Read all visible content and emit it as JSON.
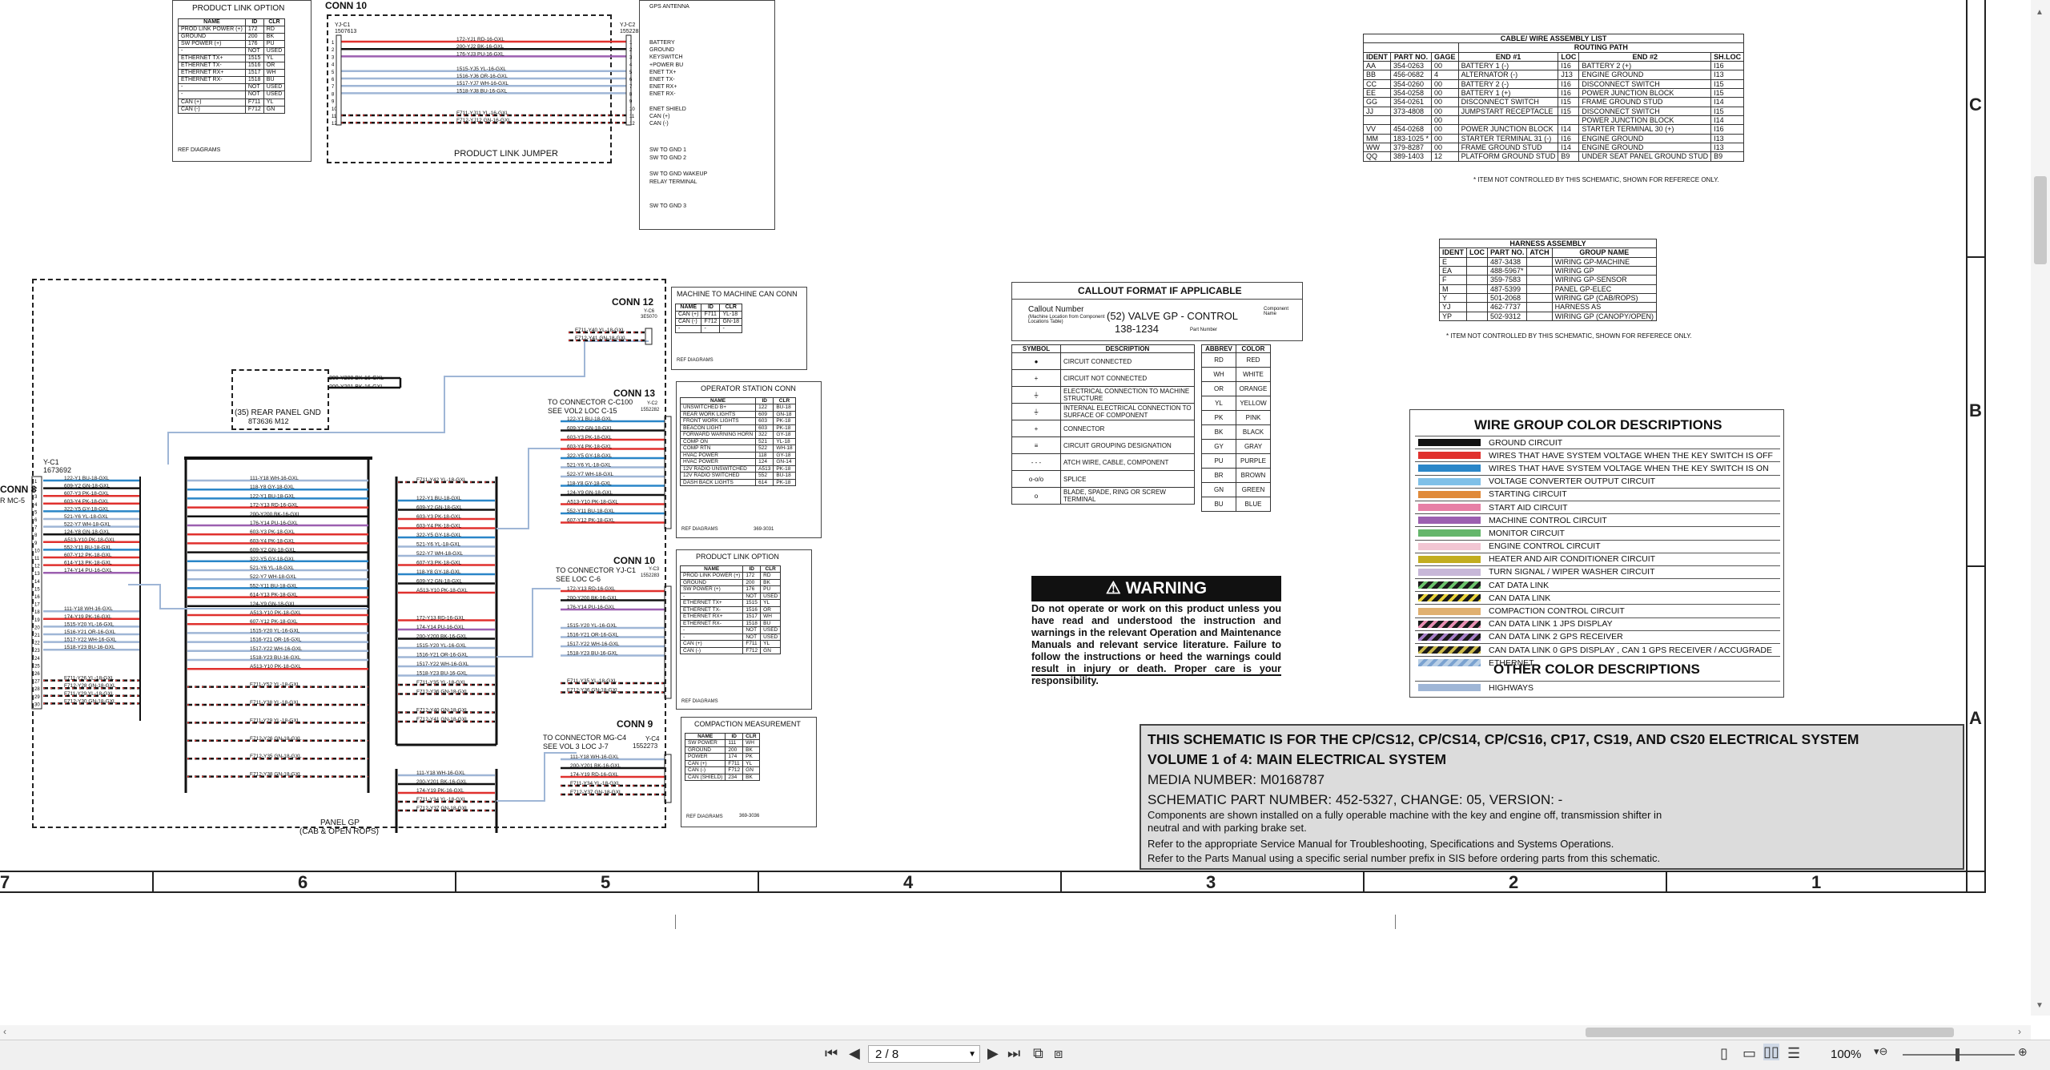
{
  "product_link_top": {
    "title": "PRODUCT LINK OPTION",
    "headers": [
      "NAME",
      "ID",
      "CLR"
    ],
    "rows": [
      [
        "PROD LINK POWER (+)",
        "172",
        "RD"
      ],
      [
        "GROUND",
        "200",
        "BK"
      ],
      [
        "SW POWER (+)",
        "176",
        "PU"
      ],
      [
        "-",
        "NOT",
        "USED"
      ],
      [
        "ETHERNET TX+",
        "1515",
        "YL"
      ],
      [
        "ETHERNET TX-",
        "1516",
        "OR"
      ],
      [
        "ETHERNET RX+",
        "1517",
        "WH"
      ],
      [
        "ETHERNET RX-",
        "1518",
        "BU"
      ],
      [
        "-",
        "NOT",
        "USED"
      ],
      [
        "-",
        "NOT",
        "USED"
      ],
      [
        "CAN (+)",
        "F711",
        "YL"
      ],
      [
        "CAN (-)",
        "F712",
        "GN"
      ]
    ],
    "ref": "REF DIAGRAMS"
  },
  "conn10_top": {
    "title": "CONN 10",
    "left_id": "YJ-C1",
    "left_part": "1507613",
    "right_id": "YJ-C2",
    "right_part": "1552283",
    "jumper": "PRODUCT LINK\nJUMPER",
    "wires": [
      "172-YJ1 RD-16-GXL",
      "200-YJ2 BK-16-GXL",
      "176-YJ3 PU-16-GXL",
      "",
      "1515-YJ5 YL-16-GXL",
      "1516-YJ6 OR-16-GXL",
      "1517-YJ7 WH-16-GXL",
      "1518-YJ8 BU-16-GXL",
      "",
      "",
      "F711-YJ11 YL-16-GXL",
      "F712-YJ12 GN-16-GXL"
    ],
    "right_labels": [
      "BATTERY",
      "GROUND",
      "KEYSWITCH",
      "+POWER BU",
      "ENET TX+",
      "ENET TX-",
      "ENET RX+",
      "ENET RX-",
      "",
      "ENET SHIELD",
      "CAN (+)",
      "CAN (-)"
    ],
    "gps_antenna": "GPS ANTENNA",
    "extra": [
      "SW TO GND 1",
      "SW TO GND 2",
      "",
      "SW TO GND WAKEUP",
      "RELAY TERMINAL",
      "",
      "",
      "SW TO GND 3"
    ]
  },
  "cable_list": {
    "title": "CABLE/ WIRE ASSEMBLY LIST",
    "routing": "ROUTING PATH",
    "headers": [
      "IDENT",
      "PART NO.",
      "GAGE",
      "END #1",
      "LOC",
      "END #2",
      "SH.LOC"
    ],
    "rows": [
      [
        "AA",
        "354-0263",
        "00",
        "BATTERY 1 (-)",
        "I16",
        "BATTERY 2 (+)",
        "I16"
      ],
      [
        "BB",
        "456-0682",
        "4",
        "ALTERNATOR (-)",
        "J13",
        "ENGINE GROUND",
        "I13"
      ],
      [
        "CC",
        "354-0260",
        "00",
        "BATTERY 2 (-)",
        "I16",
        "DISCONNECT SWITCH",
        "I15"
      ],
      [
        "EE",
        "354-0258",
        "00",
        "BATTERY 1 (+)",
        "I16",
        "POWER JUNCTION BLOCK",
        "I15"
      ],
      [
        "GG",
        "354-0261",
        "00",
        "DISCONNECT SWITCH",
        "I15",
        "FRAME GROUND STUD",
        "I14"
      ],
      [
        "JJ",
        "373-4808",
        "00",
        "JUMPSTART RECEPTACLE",
        "I15",
        "DISCONNECT SWITCH",
        "I15"
      ],
      [
        "",
        "",
        "00",
        "",
        "",
        "POWER JUNCTION BLOCK",
        "I14"
      ],
      [
        "VV",
        "454-0268",
        "00",
        "POWER JUNCTION BLOCK",
        "I14",
        "STARTER TERMINAL 30 (+)",
        "I16"
      ],
      [
        "MM",
        "183-1025 *",
        "00",
        "STARTER TERMINAL 31 (-)",
        "I16",
        "ENGINE GROUND",
        "I13"
      ],
      [
        "WW",
        "379-8287",
        "00",
        "FRAME GROUND STUD",
        "I14",
        "ENGINE GROUND",
        "I13"
      ],
      [
        "QQ",
        "389-1403",
        "12",
        "PLATFORM GROUND STUD",
        "B9",
        "UNDER SEAT PANEL GROUND STUD",
        "B9"
      ]
    ],
    "note": "* ITEM NOT CONTROLLED BY THIS SCHEMATIC, SHOWN FOR REFERECE ONLY."
  },
  "harness": {
    "title": "HARNESS ASSEMBLY",
    "headers": [
      "IDENT",
      "LOC",
      "PART NO.",
      "ATCH",
      "GROUP NAME"
    ],
    "rows": [
      [
        "E",
        "",
        "487-3438",
        "",
        "WIRING GP-MACHINE"
      ],
      [
        "EA",
        "",
        "488-5967*",
        "",
        "WIRING GP"
      ],
      [
        "F",
        "",
        "359-7583",
        "",
        "WIRING GP-SENSOR"
      ],
      [
        "M",
        "",
        "487-5399",
        "",
        "PANEL GP-ELEC"
      ],
      [
        "Y",
        "",
        "501-2068",
        "",
        "WIRING GP (CAB/ROPS)"
      ],
      [
        "YJ",
        "",
        "462-7737",
        "",
        "HARNESS AS"
      ],
      [
        "YP",
        "",
        "502-9312",
        "",
        "WIRING GP (CANOPY/OPEN)"
      ]
    ],
    "note": "* ITEM NOT CONTROLLED BY THIS SCHEMATIC, SHOWN FOR REFERECE ONLY."
  },
  "callout": {
    "title": "CALLOUT FORMAT IF APPLICABLE",
    "callout_number": "Callout Number",
    "callout_sub": "(Machine Location from Component Locations Table)",
    "valve": "(52) VALVE GP - CONTROL",
    "part": "138-1234",
    "component_name": "Component Name",
    "part_number": "Part Number"
  },
  "symbols": {
    "headers": [
      "SYMBOL",
      "DESCRIPTION"
    ],
    "rows": [
      [
        "●",
        "CIRCUIT CONNECTED"
      ],
      [
        "+",
        "CIRCUIT NOT CONNECTED"
      ],
      [
        "⏚",
        "ELECTRICAL CONNECTION TO MACHINE STRUCTURE"
      ],
      [
        "⏚",
        "INTERNAL ELECTRICAL CONNECTION TO SURFACE OF COMPONENT"
      ],
      [
        "+",
        "CONNECTOR"
      ],
      [
        "≡",
        "CIRCUIT GROUPING DESIGNATION"
      ],
      [
        "- - -",
        "ATCH WIRE, CABLE, COMPONENT"
      ],
      [
        "o-o/o",
        "SPLICE"
      ],
      [
        "o",
        "BLADE, SPADE, RING OR SCREW TERMINAL"
      ]
    ]
  },
  "abbrev": {
    "headers": [
      "ABBREV",
      "COLOR"
    ],
    "rows": [
      [
        "RD",
        "RED"
      ],
      [
        "WH",
        "WHITE"
      ],
      [
        "OR",
        "ORANGE"
      ],
      [
        "YL",
        "YELLOW"
      ],
      [
        "PK",
        "PINK"
      ],
      [
        "BK",
        "BLACK"
      ],
      [
        "GY",
        "GRAY"
      ],
      [
        "PU",
        "PURPLE"
      ],
      [
        "BR",
        "BROWN"
      ],
      [
        "GN",
        "GREEN"
      ],
      [
        "BU",
        "BLUE"
      ]
    ]
  },
  "warning": {
    "title": "WARNING",
    "text": "Do not operate or work on this product unless you have read and understood the instruction and warnings in the relevant Operation and Maintenance Manuals and relevant service literature. Failure to follow the instructions or heed the warnings could result in injury or death. Proper care is your responsibility."
  },
  "wire_colors": {
    "title": "WIRE GROUP COLOR DESCRIPTIONS",
    "rows": [
      {
        "label": "GROUND CIRCUIT",
        "color": "#111111"
      },
      {
        "label": "WIRES THAT HAVE SYSTEM VOLTAGE WHEN THE KEY SWITCH IS OFF",
        "color": "#e0312e"
      },
      {
        "label": "WIRES THAT HAVE SYSTEM VOLTAGE WHEN THE KEY SWITCH IS ON",
        "color": "#2a86c8"
      },
      {
        "label": "VOLTAGE CONVERTER OUTPUT CIRCUIT",
        "color": "#7fc0e8"
      },
      {
        "label": "STARTING CIRCUIT",
        "color": "#e08a3a"
      },
      {
        "label": "START AID CIRCUIT",
        "color": "#e77fa6"
      },
      {
        "label": "MACHINE CONTROL CIRCUIT",
        "color": "#9c5fb0"
      },
      {
        "label": "MONITOR CIRCUIT",
        "color": "#65b66b"
      },
      {
        "label": "ENGINE CONTROL CIRCUIT",
        "color": "#f2c6d3"
      },
      {
        "label": "HEATER AND AIR CONDITIONER CIRCUIT",
        "color": "#c2ad1f"
      },
      {
        "label": "TURN SIGNAL / WIPER WASHER CIRCUIT",
        "color": "#c7b7d8"
      },
      {
        "label": "CAT DATA LINK",
        "color": "stripe-green"
      },
      {
        "label": "CAN DATA LINK",
        "color": "stripe-yellow"
      },
      {
        "label": "COMPACTION CONTROL CIRCUIT",
        "color": "#e0b070"
      },
      {
        "label": "CAN DATA LINK 1 JPS DISPLAY",
        "color": "stripe-pink"
      },
      {
        "label": "CAN DATA LINK 2 GPS RECEIVER",
        "color": "stripe-purple"
      },
      {
        "label": "CAN DATA LINK 0 GPS DISPLAY , CAN 1 GPS RECEIVER / ACCUGRADE",
        "color": "stripe-olive"
      },
      {
        "label": "ETHERNET",
        "color": "stripe-blue"
      }
    ],
    "other_title": "OTHER COLOR DESCRIPTIONS",
    "other_rows": [
      {
        "label": "HIGHWAYS",
        "color": "#9fb6d6"
      }
    ]
  },
  "title_block": {
    "line1": "THIS SCHEMATIC IS FOR THE CP/CS12, CP/CS14, CP/CS16, CP17, CS19, AND CS20 ELECTRICAL SYSTEM",
    "line2": "VOLUME 1 of 4: MAIN ELECTRICAL SYSTEM",
    "line3": "MEDIA NUMBER: M0168787",
    "line4": "SCHEMATIC PART NUMBER: 452-5327, CHANGE: 05, VERSION: -",
    "line5": "Components are shown installed on a fully operable machine with the key and engine off, transmission shifter in neutral and with parking brake set.",
    "line6": "Refer to the appropriate Service Manual for Troubleshooting, Specifications and Systems Operations.",
    "line7": "Refer to the Parts Manual using a specific serial number prefix in SIS before ordering parts from this schematic."
  },
  "conn12": {
    "title": "CONN 12",
    "id": "Y-C6",
    "part": "3E5070",
    "wires": [
      "F711-Y40 YL-18-GXL",
      "F712-Y41 GN-18-GXL"
    ],
    "table_title": "MACHINE TO MACHINE CAN CONN",
    "headers": [
      "NAME",
      "ID",
      "CLR"
    ],
    "rows": [
      [
        "CAN (+)",
        "F711",
        "YL-18"
      ],
      [
        "CAN (-)",
        "F712",
        "GN-18"
      ],
      [
        "-",
        "-",
        "-"
      ]
    ],
    "ref": "REF DIAGRAMS"
  },
  "conn13": {
    "title": "CONN 13",
    "to": "TO CONNECTOR C-C100",
    "see": "SEE VOL2 LOC C-15",
    "id": "Y-C2",
    "part": "1552282",
    "wires": [
      "122-Y1 BU-18-GXL",
      "609-Y2 GN-18-GXL",
      "603-Y3 PK-18-GXL",
      "603-Y4 PK-18-GXL",
      "322-Y5 GY-18-GXL",
      "521-Y6 YL-18-GXL",
      "522-Y7 WH-18-GXL",
      "118-Y8 GY-18-GXL",
      "124-Y9 GN-18-GXL",
      "A513-Y10 PK-18-GXL",
      "552-Y11 BU-18-GXL",
      "607-Y12 PK-18-GXL"
    ],
    "table_title": "OPERATOR STATION CONN",
    "headers": [
      "NAME",
      "ID",
      "CLR"
    ],
    "rows": [
      [
        "UNSWITCHED B+",
        "122",
        "BU-18"
      ],
      [
        "REAR WORK LIGHTS",
        "609",
        "GN-18"
      ],
      [
        "FRONT WORK LIGHTS",
        "603",
        "PK-18"
      ],
      [
        "BEACON LIGHT",
        "603",
        "PK-18"
      ],
      [
        "FORWARD WARNING HORN",
        "322",
        "GY-18"
      ],
      [
        "COMP ON",
        "521",
        "YL-18"
      ],
      [
        "COMP RTN",
        "522",
        "WH-18"
      ],
      [
        "HVAC POWER",
        "118",
        "GY-18"
      ],
      [
        "HVAC POWER",
        "124",
        "GN-14"
      ],
      [
        "12V RADIO UNSWITCHED",
        "A513",
        "PK-18"
      ],
      [
        "12V RADIO SWITCHED",
        "552",
        "BU-18"
      ],
      [
        "DASH BACK LIGHTS",
        "614",
        "PK-18"
      ]
    ],
    "ref": "REF DIAGRAMS",
    "ref_num": "369-3031"
  },
  "conn10": {
    "title": "CONN 10",
    "to": "TO CONNECTOR YJ-C1",
    "see": "SEE LOC C-6",
    "id": "Y-C3",
    "part": "1552283",
    "wires": [
      "172-Y13 RD-16-GXL",
      "200-Y200 BK-16-GXL",
      "176-Y14 PU-16-GXL",
      "",
      "1515-Y20 YL-16-GXL",
      "1516-Y21 OR-16-GXL",
      "1517-Y22 WH-16-GXL",
      "1518-Y23 BU-16-GXL",
      "",
      "",
      "F711-Y35 YL-18-GXL",
      "F712-Y36 GN-18-GXL"
    ],
    "table_title": "PRODUCT LINK OPTION",
    "headers": [
      "NAME",
      "ID",
      "CLR"
    ],
    "rows": [
      [
        "PROD LINK POWER (+)",
        "172",
        "RD"
      ],
      [
        "GROUND",
        "200",
        "BK"
      ],
      [
        "SW POWER (+)",
        "176",
        "PU"
      ],
      [
        "-",
        "NOT",
        "USED"
      ],
      [
        "ETHERNET TX+",
        "1515",
        "YL"
      ],
      [
        "ETHERNET TX-",
        "1516",
        "OR"
      ],
      [
        "ETHERNET RX+",
        "1517",
        "WH"
      ],
      [
        "ETHERNET RX-",
        "1518",
        "BU"
      ],
      [
        "-",
        "NOT",
        "USED"
      ],
      [
        "-",
        "NOT",
        "USED"
      ],
      [
        "CAN (+)",
        "F711",
        "YL"
      ],
      [
        "CAN (-)",
        "F712",
        "GN"
      ]
    ],
    "ref": "REF DIAGRAMS"
  },
  "conn9": {
    "title": "CONN 9",
    "to": "TO CONNECTOR MG-C4",
    "see": "SEE VOL 3 LOC J-7",
    "id": "Y-C4",
    "part": "1552273",
    "wires": [
      "111-Y18 WH-16-GXL",
      "200-Y201 BK-16-GXL",
      "174-Y19 RD-16-GXL",
      "F711-Y34 YL-18-GXL",
      "F712-Y37 GN-18-GXL"
    ],
    "table_title": "COMPACTION MEASUREMENT",
    "headers": [
      "NAME",
      "ID",
      "CLR"
    ],
    "rows": [
      [
        "SW POWER",
        "111",
        "WH"
      ],
      [
        "GROUND",
        "200",
        "BK"
      ],
      [
        "POWER",
        "174",
        "PK"
      ],
      [
        "CAN (+)",
        "F711",
        "YL"
      ],
      [
        "CAN (-)",
        "F712",
        "GN"
      ],
      [
        "CAN (SHIELD)",
        "234",
        "BK"
      ]
    ],
    "ref": "REF DIAGRAMS",
    "ref_num": "369-3036"
  },
  "conn8": {
    "title": "CONN 8",
    "sub": "R MC-5",
    "id": "Y-C1",
    "part": "1673692",
    "wires": [
      "122-Y1 BU-18-GXL",
      "609-Y2 GN-18-GXL",
      "607-Y3 PK-18-GXL",
      "603-Y4 PK-18-GXL",
      "322-Y5 GY-18-GXL",
      "521-Y6 YL-18-GXL",
      "522-Y7 WH-18-GXL",
      "124-Y8 GN-18-GXL",
      "A513-Y10 PK-18-GXL",
      "552-Y11 BU-18-GXL",
      "607-Y12 PK-18-GXL",
      "614-Y13 PK-18-GXL",
      "174-Y14 PU-16-GXL",
      "",
      "",
      "",
      "",
      "111-Y18 WH-16-GXL",
      "174-Y19 PK-16-GXL",
      "1515-Y20 YL-16-GXL",
      "1516-Y21 OR-16-GXL",
      "1517-Y22 WH-16-GXL",
      "1518-Y23 BU-16-GXL",
      "",
      "",
      "",
      "F711-Y26 YL-18-GXL",
      "F712-Y28 GN-18-GXL",
      "F711-Y29 YL-18-GXL",
      "F712-Y30 GN-18-GXL"
    ]
  },
  "rear_panel": {
    "top_wires": [
      "200-Y200 BK-16-GXL",
      "200-Y201 BK-16-GXL"
    ],
    "label": "(35) REAR PANEL GND",
    "part": "8T3636 M12"
  },
  "panel_gp": {
    "label": "PANEL GP",
    "sub": "(CAB & OPEN ROPS)"
  },
  "zones_bottom": [
    "7",
    "6",
    "5",
    "4",
    "3",
    "2",
    "1"
  ],
  "zones_right": [
    "C",
    "B",
    "A"
  ],
  "toolbar": {
    "page": "2 / 8",
    "zoom": "100%"
  }
}
